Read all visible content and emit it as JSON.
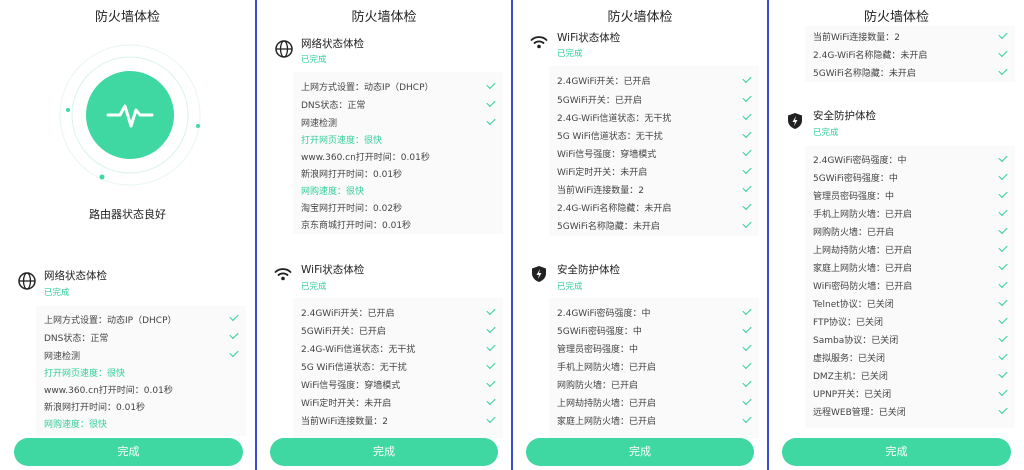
{
  "page_title": "防火墙体检",
  "done_label": "完成",
  "status_text": "路由器状态良好",
  "completed_label": "已完成",
  "sections": {
    "network": "网络状态体检",
    "wifi": "WiFi状态体检",
    "security": "安全防护体检"
  },
  "network_rows": [
    "上网方式设置：动态IP（DHCP）",
    "DNS状态：正常",
    "网速检测",
    "打开网页速度：很快",
    "www.360.cn打开时间：0.01秒",
    "新浪网打开时间：0.01秒",
    "网购速度：很快",
    "淘宝网打开时间：0.02秒",
    "京东商城打开时间：0.01秒"
  ],
  "wifi_rows": [
    "2.4GWiFi开关：已开启",
    "5GWiFi开关：已开启",
    "2.4G-WiFi信道状态：无干扰",
    "5G WiFi信道状态：无干扰",
    "WiFi信号强度：穿墙模式",
    "WiFi定时开关：未开启",
    "当前WiFi连接数量：2",
    "2.4G-WiFi名称隐藏：未开启",
    "5GWiFi名称隐藏：未开启"
  ],
  "security_rows": [
    "2.4GWiFi密码强度：中",
    "5GWiFi密码强度：中",
    "管理员密码强度：中",
    "手机上网防火墙：已开启",
    "网购防火墙：已开启",
    "上网劫持防火墙：已开启",
    "家庭上网防火墙：已开启",
    "WiFi密码防火墙：已开启",
    "Telnet协议：已关闭",
    "FTP协议：已关闭",
    "Samba协议：已关闭",
    "虚拟服务：已关闭",
    "DMZ主机：已关闭",
    "UPNP开关：已关闭",
    "远程WEB管理：已关闭"
  ],
  "colors": {
    "accent": "#3fd8a2",
    "divider": "#3b4bd1"
  }
}
